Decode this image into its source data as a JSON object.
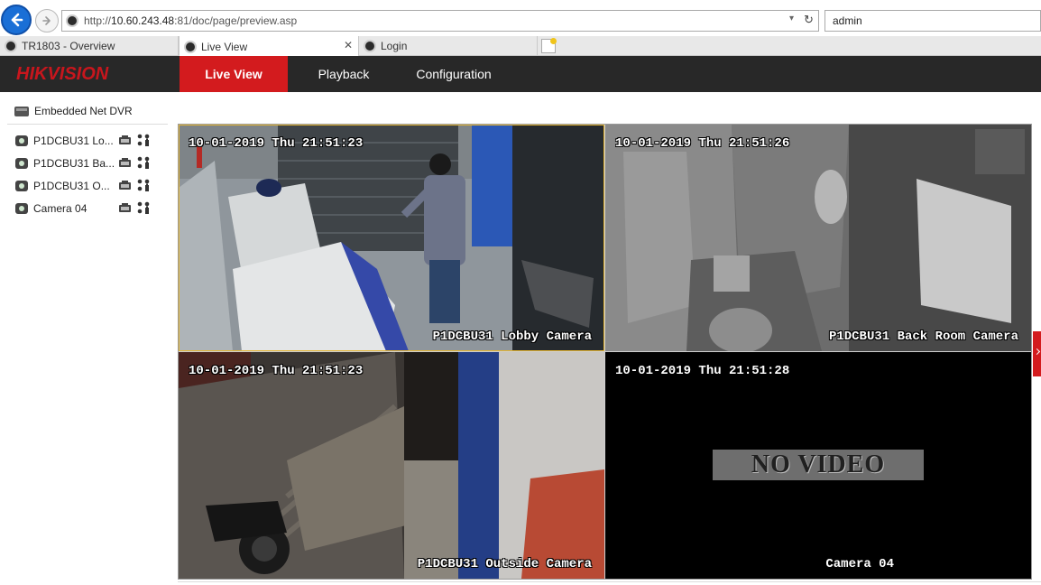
{
  "browser": {
    "url_prefix": "http://",
    "url_host": "10.60.243.48",
    "url_rest": ":81/doc/page/preview.asp",
    "search_value": "admin",
    "tabs": [
      {
        "label": "TR1803 - Overview"
      },
      {
        "label": "Live View",
        "active": true,
        "close": "✕"
      },
      {
        "label": "Login"
      }
    ]
  },
  "header": {
    "brand": "HIKVISION",
    "nav": [
      {
        "label": "Live View",
        "active": true
      },
      {
        "label": "Playback"
      },
      {
        "label": "Configuration"
      }
    ]
  },
  "sidebar": {
    "device_title": "Embedded Net DVR",
    "cameras": [
      {
        "label": "P1DCBU31 Lo..."
      },
      {
        "label": "P1DCBU31 Ba..."
      },
      {
        "label": "P1DCBU31 O..."
      },
      {
        "label": "Camera 04"
      }
    ]
  },
  "video": {
    "tiles": [
      {
        "timestamp": "10-01-2019 Thu 21:51:23",
        "name": "P1DCBU31 Lobby Camera",
        "selected": true
      },
      {
        "timestamp": "10-01-2019 Thu 21:51:26",
        "name": "P1DCBU31 Back Room Camera"
      },
      {
        "timestamp": "10-01-2019 Thu 21:51:23",
        "name": "P1DCBU31 Outside Camera"
      },
      {
        "timestamp": "10-01-2019 Thu 21:51:28",
        "name": "Camera 04",
        "status": "NO VIDEO"
      }
    ]
  },
  "colors": {
    "brand_red": "#d31b1e",
    "header_bg": "#282828",
    "selected_outline": "#e4b533"
  },
  "icons": {
    "back": "back-arrow-icon",
    "forward": "forward-arrow-icon",
    "refresh": "refresh-icon",
    "record": "record-icon",
    "ptz": "ptz-control-icon",
    "camera": "camera-icon",
    "dvr": "dvr-device-icon"
  }
}
